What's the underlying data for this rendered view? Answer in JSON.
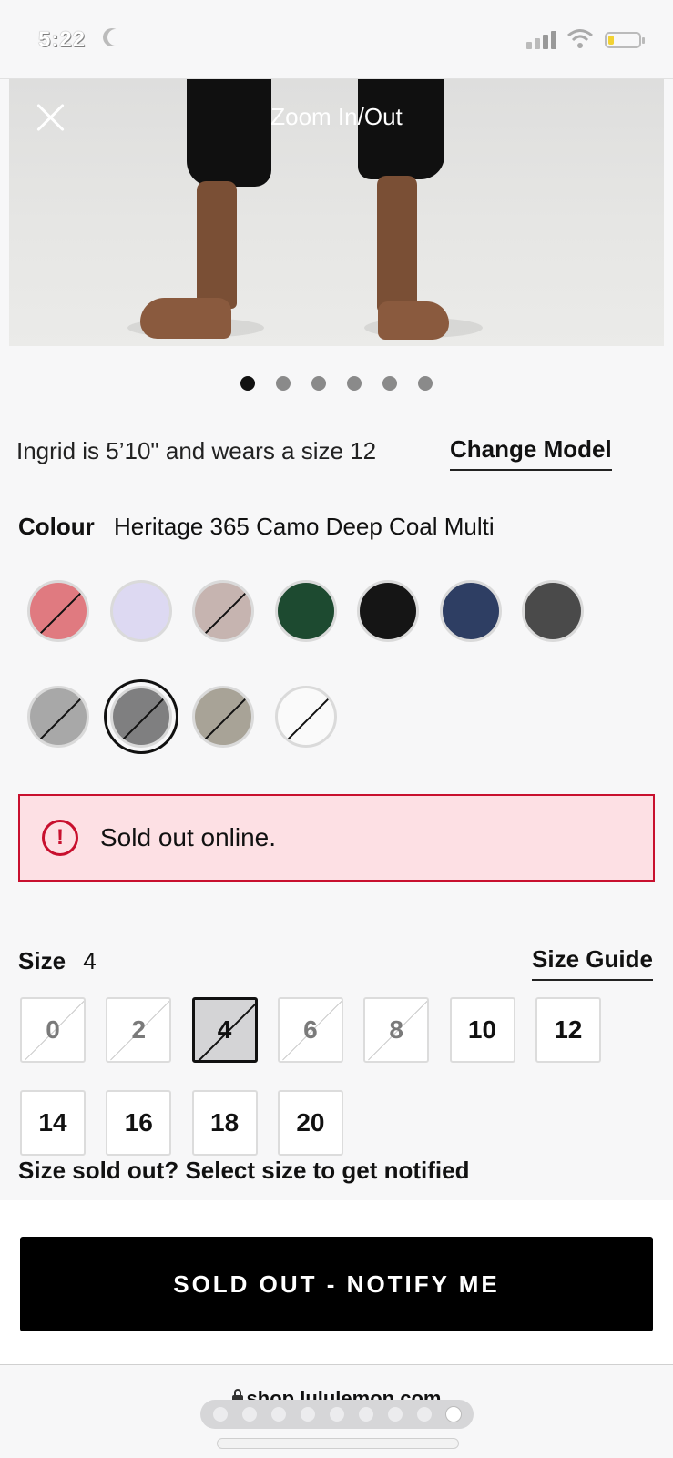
{
  "status_bar": {
    "time": "5:22"
  },
  "hero": {
    "zoom_label": "Zoom In/Out"
  },
  "carousel": {
    "dots": 6,
    "active": 0
  },
  "model": {
    "text": "Ingrid is 5’10\" and wears a size 12",
    "change_label": "Change Model"
  },
  "colour": {
    "label": "Colour",
    "value": "Heritage 365 Camo Deep Coal Multi",
    "swatches": [
      {
        "name": "pink",
        "color": "#e07a80",
        "sold_out": true
      },
      {
        "name": "lavender",
        "color": "#ddd9f2",
        "sold_out": false
      },
      {
        "name": "taupe",
        "color": "#c6b4b0",
        "sold_out": true
      },
      {
        "name": "green",
        "color": "#1d4a30",
        "sold_out": false
      },
      {
        "name": "black",
        "color": "#151515",
        "sold_out": false
      },
      {
        "name": "navy",
        "color": "#2e3e63",
        "sold_out": false
      },
      {
        "name": "charcoal",
        "color": "#4a4a4a",
        "sold_out": false
      },
      {
        "name": "light-grey-camo",
        "color": "#a8a8a8",
        "sold_out": true
      },
      {
        "name": "heritage-camo-deep-coal",
        "color": "#7f7f80",
        "sold_out": true,
        "selected": true
      },
      {
        "name": "khaki",
        "color": "#a8a397",
        "sold_out": true
      },
      {
        "name": "white",
        "color": "#fafafa",
        "sold_out": true
      }
    ]
  },
  "alert": {
    "icon": "!",
    "text": "Sold out online."
  },
  "size": {
    "label": "Size",
    "value": "4",
    "guide_label": "Size Guide",
    "options": [
      {
        "label": "0",
        "sold_out": true
      },
      {
        "label": "2",
        "sold_out": true
      },
      {
        "label": "4",
        "sold_out": true,
        "selected": true
      },
      {
        "label": "6",
        "sold_out": true
      },
      {
        "label": "8",
        "sold_out": true
      },
      {
        "label": "10",
        "sold_out": false
      },
      {
        "label": "12",
        "sold_out": false
      },
      {
        "label": "14",
        "sold_out": false
      },
      {
        "label": "16",
        "sold_out": false
      },
      {
        "label": "18",
        "sold_out": false
      },
      {
        "label": "20",
        "sold_out": false
      }
    ],
    "hint": "Size sold out? Select size to get notified"
  },
  "cta": {
    "label": "SOLD OUT - NOTIFY ME"
  },
  "browser": {
    "url": "shop.lululemon.com"
  }
}
